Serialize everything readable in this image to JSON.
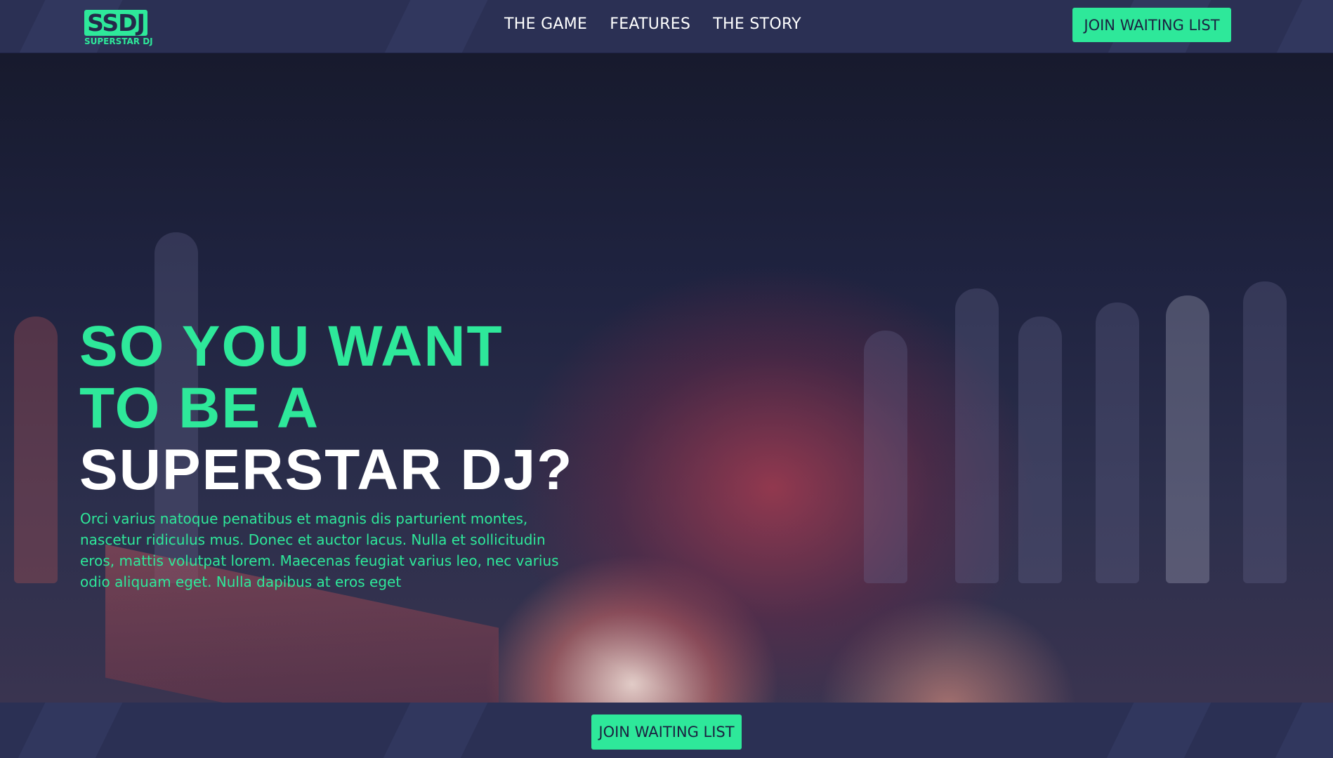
{
  "logo": {
    "text": "SSDJ",
    "subtext": "SUPERSTAR DJ"
  },
  "nav": {
    "items": [
      {
        "label": "THE GAME"
      },
      {
        "label": "FEATURES"
      },
      {
        "label": "THE STORY"
      }
    ]
  },
  "header": {
    "cta_label": "JOIN WAITING LIST"
  },
  "hero": {
    "heading_line1": "SO YOU WANT",
    "heading_line2": "TO BE A",
    "heading_line3": "SUPERSTAR DJ?",
    "body": "Orci varius natoque penatibus et magnis dis parturient montes, nascetur ridiculus mus. Donec et auctor lacus. Nulla et sollicitudin eros, mattis volutpat lorem. Maecenas feugiat varius leo, nec varius odio aliquam eget. Nulla dapibus at eros eget"
  },
  "footer": {
    "cta_label": "JOIN WAITING LIST"
  },
  "icons": {
    "sound": "speaker-volume-icon"
  },
  "colors": {
    "accent": "#2ee89a",
    "bar": "#2b3054",
    "text": "#ffffff"
  }
}
